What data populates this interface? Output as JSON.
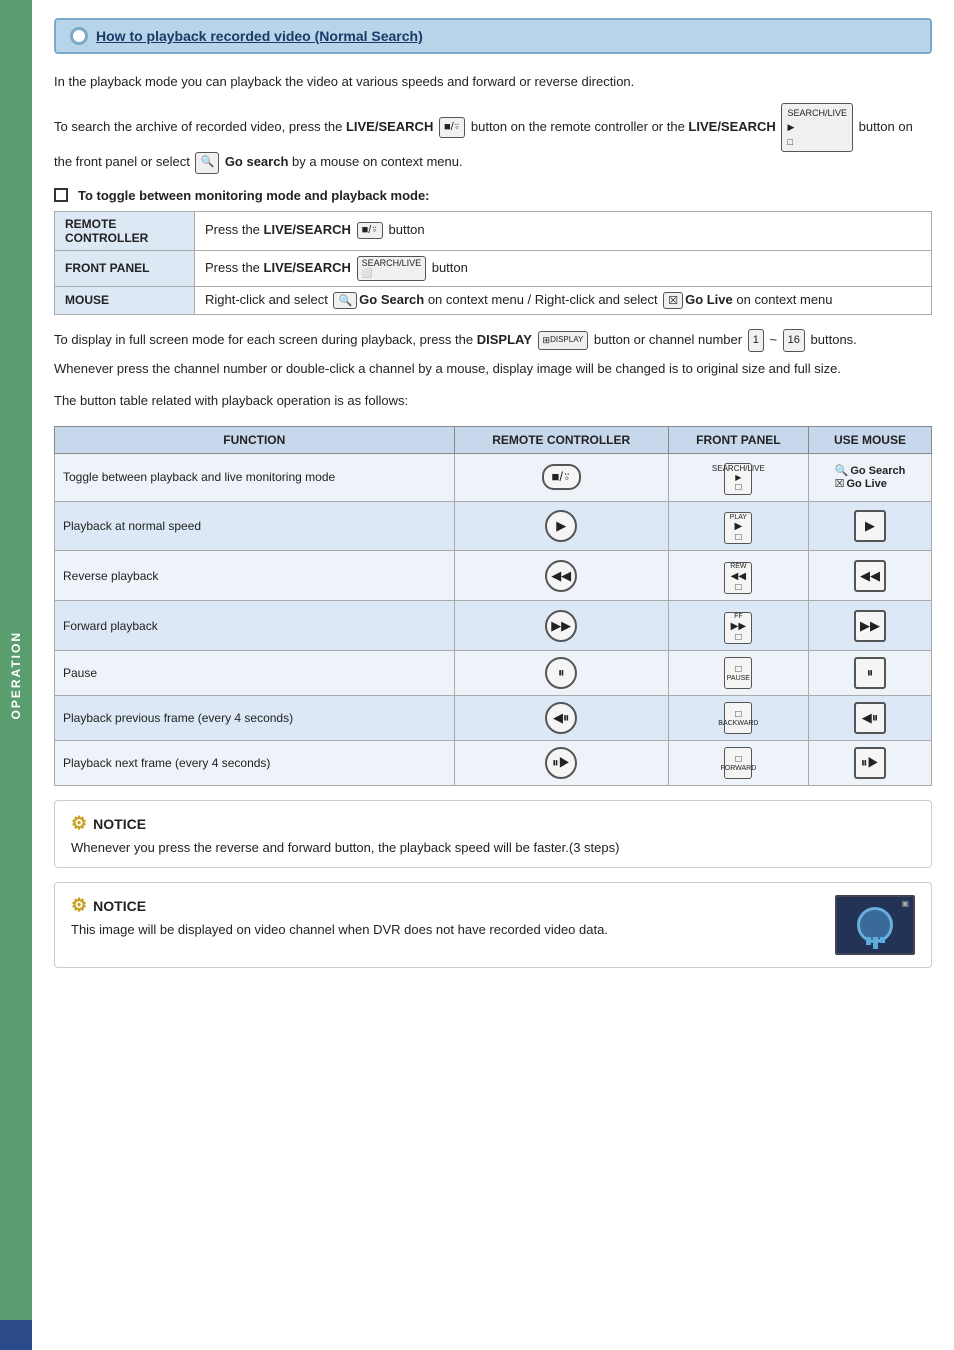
{
  "page": {
    "title": "How to playback recorded video (Normal Search)",
    "sidebar_label": "OPERATION"
  },
  "intro": {
    "para1": "In the playback mode you can playback the video at various speeds and forward or reverse direction.",
    "para2_prefix": "To search the archive of recorded video, press the ",
    "para2_live_search": "LIVE/SEARCH",
    "para2_middle": " button on the remote controller or the ",
    "para2_live_search2": "LIVE/SEARCH",
    "para2_suffix": " button on the front panel or select",
    "para2_go_search": "Go search",
    "para2_end": " by a mouse on context menu."
  },
  "toggle_section": {
    "title": "To toggle between monitoring mode and playback mode:",
    "rows": [
      {
        "label": "REMOTE CONTROLLER",
        "desc_prefix": "Press the ",
        "desc_bold": "LIVE/SEARCH",
        "desc_suffix": " button"
      },
      {
        "label": "FRONT PANEL",
        "desc_prefix": "Press the ",
        "desc_bold": "LIVE/SEARCH",
        "desc_suffix": " button"
      },
      {
        "label": "MOUSE",
        "desc_prefix": "Right-click and select ",
        "desc_bold1": "Go Search",
        "desc_mid": " on context menu / Right-click and select ",
        "desc_bold2": "Go Live",
        "desc_end": " on context menu"
      }
    ]
  },
  "display_section": {
    "text1": "To display in full screen mode for each screen during playback, press the",
    "display_bold": "DISPLAY",
    "text2": "button or channel number",
    "channel_start": "1",
    "channel_tilde": "~",
    "channel_end": "16",
    "text3": "buttons.",
    "text4": "Whenever press the channel number or double-click a channel by a mouse, display image will be changed is to original size and full size.",
    "table_intro": "The button table related with playback operation is as follows:"
  },
  "func_table": {
    "headers": [
      "FUNCTION",
      "REMOTE CONTROLLER",
      "FRONT PANEL",
      "USE MOUSE"
    ],
    "rows": [
      {
        "function": "Toggle between playback and live monitoring mode",
        "remote": "■/⍤",
        "remote_type": "oval",
        "front": "SEARCH/LIVE",
        "front_type": "square_search",
        "mouse": "🔍 Go Search\n☒Go Live",
        "mouse_type": "text_gosearch"
      },
      {
        "function": "Playback at normal speed",
        "remote": "▶",
        "remote_type": "circle",
        "front": "PLAY",
        "front_type": "square_play",
        "mouse": "▶",
        "mouse_type": "square"
      },
      {
        "function": "Reverse playback",
        "remote": "◀◀",
        "remote_type": "circle",
        "front": "REW",
        "front_type": "square_rew",
        "mouse": "◀◀",
        "mouse_type": "square"
      },
      {
        "function": "Forward playback",
        "remote": "▶▶",
        "remote_type": "circle",
        "front": "FF",
        "front_type": "square_ff",
        "mouse": "▶▶",
        "mouse_type": "square"
      },
      {
        "function": "Pause",
        "remote": "⏸",
        "remote_type": "circle",
        "front": "PAUSE",
        "front_type": "square_pause",
        "mouse": "⏸",
        "mouse_type": "square"
      },
      {
        "function": "Playback previous frame (every 4 seconds)",
        "remote": "◀⏸",
        "remote_type": "circle",
        "front": "BACKWARD",
        "front_type": "square_backward",
        "mouse": "◀⏸",
        "mouse_type": "square"
      },
      {
        "function": "Playback next frame (every 4 seconds)",
        "remote": "⏸▶",
        "remote_type": "circle",
        "front": "FORWARD",
        "front_type": "square_forward",
        "mouse": "⏸▶",
        "mouse_type": "square"
      }
    ]
  },
  "notices": [
    {
      "title": "NOTICE",
      "text": "Whenever you press the reverse and forward button, the playback speed will be faster.(3 steps)"
    },
    {
      "title": "NOTICE",
      "text": "This image will be displayed on video channel when DVR does not have recorded video data.",
      "has_image": true
    }
  ]
}
